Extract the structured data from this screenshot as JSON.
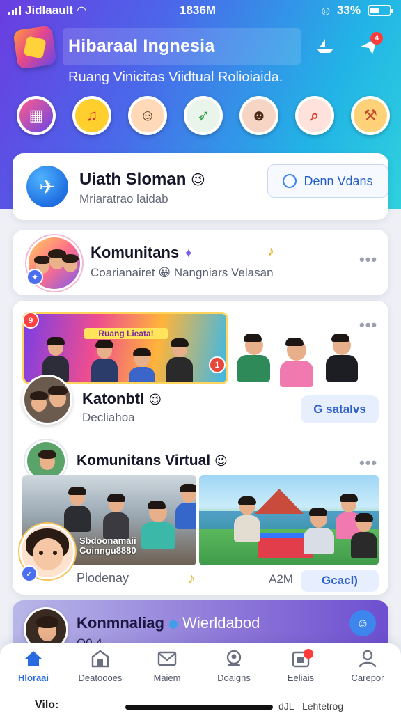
{
  "status_bar": {
    "carrier": "Jidlaault",
    "time": "1836M",
    "battery": "33%"
  },
  "header": {
    "title": "Hibaraal Ingnesia",
    "subtitle": "Ruang Vinicitas Viidtual Rolioiaida."
  },
  "welcome_card": {
    "name": "Uiath Sloman",
    "emoji": "😉",
    "sub": "Mriaratrao laidab",
    "button_label": "Denn Vdans"
  },
  "community_row": {
    "title": "Komunitans",
    "badge": "✦",
    "sub_prefix": "Coarianairet",
    "sub_emoji": "😀",
    "sub_suffix": "Nangniars Velasan",
    "music": "♪",
    "more": "•••"
  },
  "post_one": {
    "banner_text": "Ruang Lieata!",
    "badge_top": "9",
    "badge_right": "1",
    "name": "Katonbtl",
    "emoji": "😉",
    "sub": "Decliahoa",
    "button_label": "G satalvs",
    "more": "•••"
  },
  "post_two": {
    "title": "Komunitans Virtual",
    "emoji": "😉",
    "overlay_text": "Sbdoonamaii Coinngu8880",
    "footer_left": "Plodenay",
    "music": "♪",
    "time": "A2M",
    "button_label": "Gcacl)",
    "more": "•••"
  },
  "promo_card": {
    "title": "Konmnaliag",
    "title_suffix": "Wierldabod",
    "sub": "Q0.4"
  },
  "bottom_nav": {
    "items": [
      {
        "label": "Hloraai",
        "icon": "home-icon",
        "active": true
      },
      {
        "label": "Deatoooes",
        "icon": "shop-icon",
        "active": false
      },
      {
        "label": "Maiem",
        "icon": "mail-icon",
        "active": false
      },
      {
        "label": "Doaigns",
        "icon": "profile-search-icon",
        "active": false
      },
      {
        "label": "Eeliais",
        "icon": "calendar-icon",
        "active": false
      },
      {
        "label": "Carepor",
        "icon": "user-icon",
        "active": false
      }
    ]
  },
  "peek": {
    "left": "Vilo:",
    "right_prefix": "dJL",
    "right": "Lehtetrog"
  },
  "colors": {
    "accent": "#2a6ae0",
    "header_start": "#6a3de0",
    "header_end": "#2fd1dd"
  }
}
